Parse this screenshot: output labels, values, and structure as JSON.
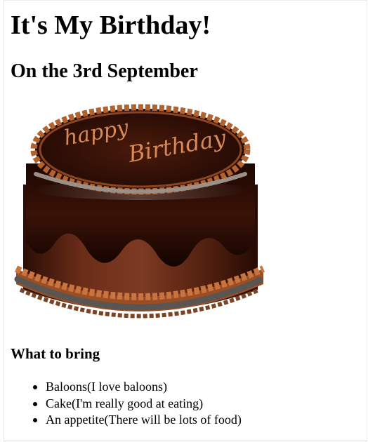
{
  "page": {
    "title": "It's My Birthday!",
    "subtitle": "On the 3rd September",
    "image": {
      "name": "birthday-cake",
      "inscription": "happy Birthday"
    },
    "section_heading": "What to bring",
    "bring_items": [
      "Baloons(I love baloons)",
      "Cake(I'm really good at eating)",
      "An appetite(There will be lots of food)"
    ]
  }
}
